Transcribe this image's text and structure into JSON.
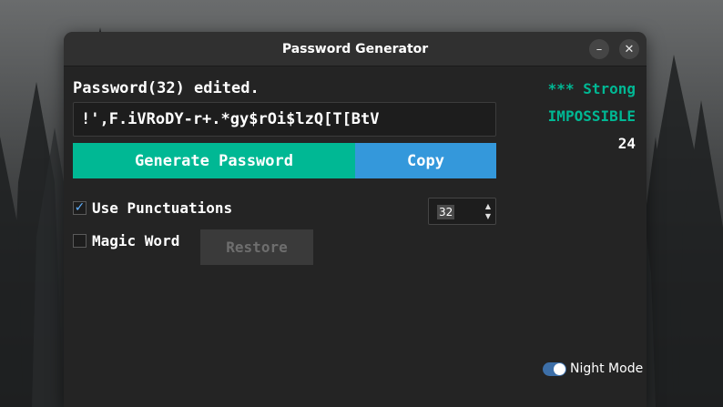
{
  "window": {
    "title": "Password Generator",
    "minimize_glyph": "–",
    "close_glyph": "✕"
  },
  "status": {
    "label": "Password(32) edited."
  },
  "password": {
    "value": "!',F.iVRoDY-r+.*gy$rOi$lzQ[T[BtV"
  },
  "actions": {
    "generate_label": "Generate Password",
    "copy_label": "Copy",
    "restore_label": "Restore"
  },
  "strength": {
    "rating": "*** Strong",
    "crack_time": "IMPOSSIBLE",
    "score": "24"
  },
  "options": {
    "punctuations_label": "Use Punctuations",
    "punctuations_checked": true,
    "magic_word_label": "Magic Word",
    "magic_word_checked": false,
    "length_value": "32"
  },
  "night_mode": {
    "label": "Night Mode",
    "enabled": true
  },
  "colors": {
    "accent_green": "#00b894",
    "accent_blue": "#3498db",
    "window_bg": "#242424"
  }
}
